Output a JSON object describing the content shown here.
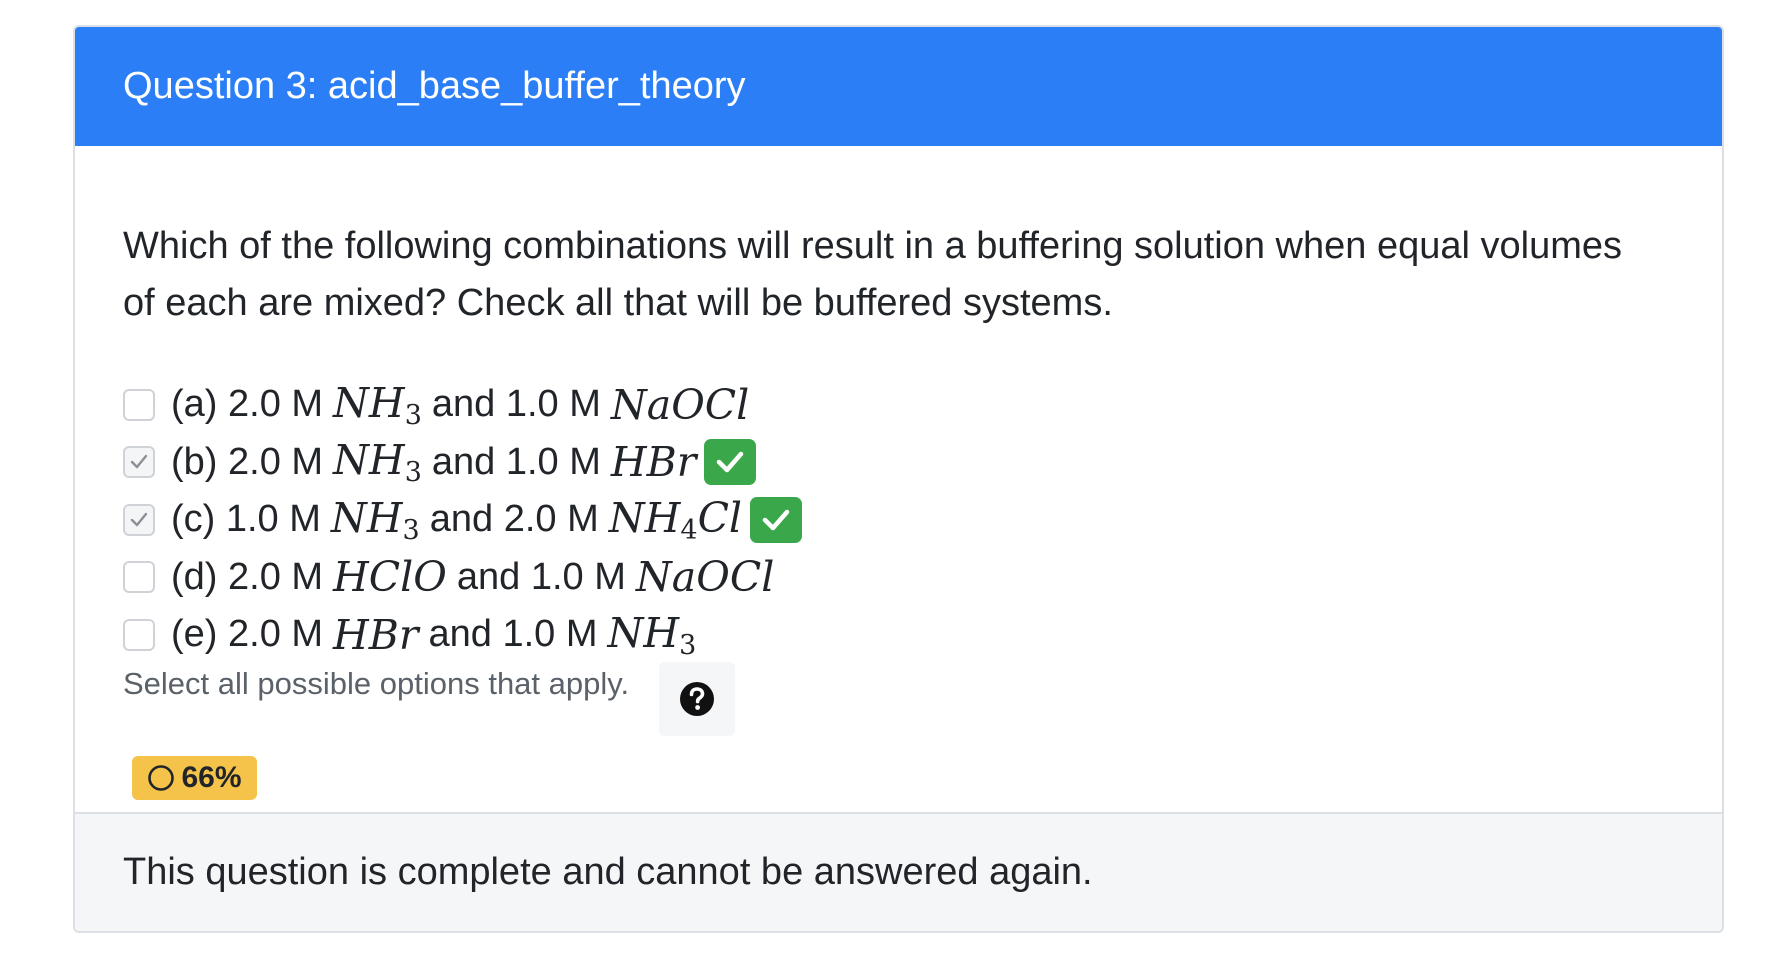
{
  "header": {
    "title": "Question 3: acid_base_buffer_theory",
    "color": "#2b7ef6"
  },
  "question": {
    "text": "Which of the following combinations will result in a buffering solution when equal volumes of each are mixed? Check all that will be buffered systems."
  },
  "options": [
    {
      "label": "(a) 2.0 M",
      "species1": "NH",
      "species1_sub": "3",
      "connector": "and 1.0 M",
      "species2": "NaOCl",
      "species2_sub": "",
      "checked": false,
      "marked_correct": false
    },
    {
      "label": "(b) 2.0 M",
      "species1": "NH",
      "species1_sub": "3",
      "connector": "and 1.0 M",
      "species2": "HBr",
      "species2_sub": "",
      "checked": true,
      "marked_correct": true
    },
    {
      "label": "(c) 1.0 M",
      "species1": "NH",
      "species1_sub": "3",
      "connector": "and 2.0 M",
      "species2": "NH",
      "species2_sub": "4",
      "species2_tail": "Cl",
      "checked": true,
      "marked_correct": true
    },
    {
      "label": "(d) 2.0 M",
      "species1": "HClO",
      "species1_sub": "",
      "connector": "and 1.0 M",
      "species2": "NaOCl",
      "species2_sub": "",
      "checked": false,
      "marked_correct": false
    },
    {
      "label": "(e) 2.0 M",
      "species1": "HBr",
      "species1_sub": "",
      "connector": "and 1.0 M",
      "species2": "NH",
      "species2_sub": "3",
      "checked": false,
      "marked_correct": false
    }
  ],
  "help": {
    "text": "Select all possible options that apply.",
    "icon": "question-circle-icon"
  },
  "score": {
    "value": "66%",
    "icon": "circle-outline-icon",
    "color": "#f5c34a"
  },
  "footer": {
    "text": "This question is complete and cannot be answered again."
  },
  "colors": {
    "correct": "#3aa84a"
  }
}
